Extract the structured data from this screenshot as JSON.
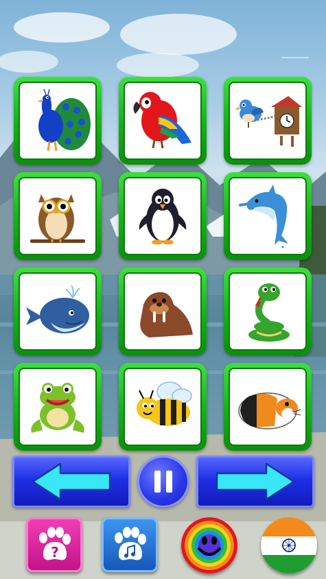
{
  "grid": {
    "animals": [
      {
        "name": "peacock"
      },
      {
        "name": "parrot"
      },
      {
        "name": "cuckoo"
      },
      {
        "name": "owl"
      },
      {
        "name": "penguin"
      },
      {
        "name": "dolphin"
      },
      {
        "name": "whale"
      },
      {
        "name": "walrus"
      },
      {
        "name": "snake"
      },
      {
        "name": "frog"
      },
      {
        "name": "bee"
      },
      {
        "name": "guinea-pig"
      }
    ]
  },
  "controls": {
    "previous_icon": "left-arrow-icon",
    "pause_icon": "pause-icon",
    "next_icon": "right-arrow-icon"
  },
  "bottom_bar": {
    "quiz_icon": "paw-question-icon",
    "sound_icon": "paw-music-icon",
    "smiley_icon": "rainbow-smiley-icon",
    "language_icon": "india-flag-icon"
  },
  "colors": {
    "tile_border": "#16b516",
    "nav_blue": "#2030e6",
    "arrow_cyan": "#38e6f5",
    "quiz_pink": "#d61a9a",
    "sound_blue": "#1a6fd6"
  }
}
